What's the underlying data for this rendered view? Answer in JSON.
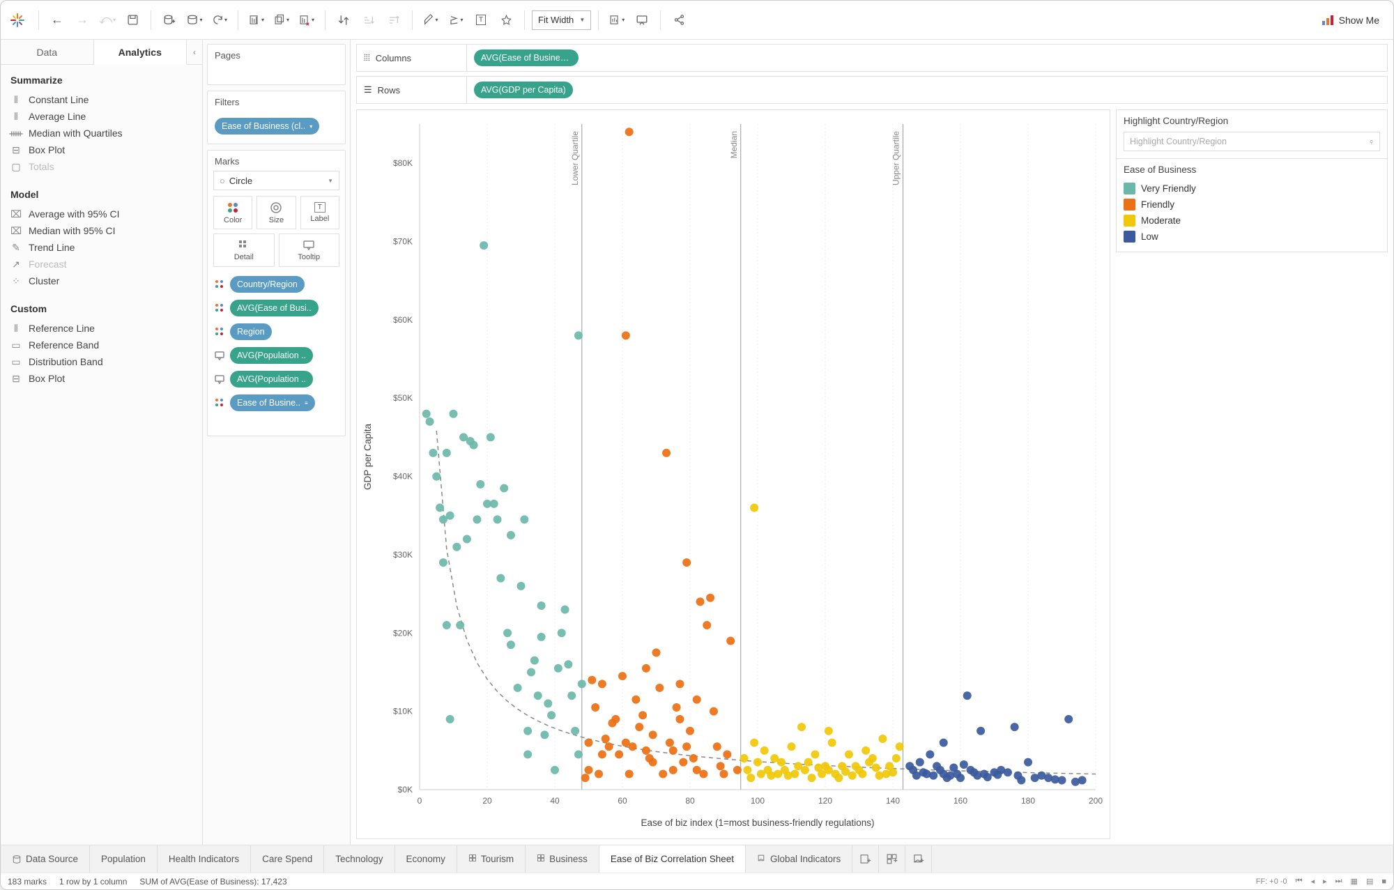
{
  "toolbar": {
    "fit_label": "Fit Width",
    "showme_label": "Show Me"
  },
  "left_tabs": {
    "data": "Data",
    "analytics": "Analytics"
  },
  "analytics": {
    "summarize": {
      "title": "Summarize",
      "items": [
        "Constant Line",
        "Average Line",
        "Median with Quartiles",
        "Box Plot",
        "Totals"
      ],
      "disabled": [
        4
      ]
    },
    "model": {
      "title": "Model",
      "items": [
        "Average with 95% CI",
        "Median with 95% CI",
        "Trend Line",
        "Forecast",
        "Cluster"
      ],
      "disabled": [
        3
      ]
    },
    "custom": {
      "title": "Custom",
      "items": [
        "Reference Line",
        "Reference Band",
        "Distribution Band",
        "Box Plot"
      ]
    }
  },
  "cards": {
    "pages": "Pages",
    "filters": "Filters",
    "filter_pill": "Ease of Business (cl..",
    "marks": "Marks",
    "mark_type": "Circle",
    "mark_cells": [
      "Color",
      "Size",
      "Label",
      "Detail",
      "Tooltip"
    ],
    "mark_pills": [
      {
        "color": "blue",
        "label": "Country/Region"
      },
      {
        "color": "teal",
        "label": "AVG(Ease of Busi.."
      },
      {
        "color": "blue",
        "label": "Region"
      },
      {
        "color": "teal",
        "label": "AVG(Population .."
      },
      {
        "color": "teal",
        "label": "AVG(Population .."
      },
      {
        "color": "blue",
        "label": "Ease of Busine.."
      }
    ]
  },
  "shelves": {
    "columns": "Columns",
    "columns_pill": "AVG(Ease of Business)",
    "rows": "Rows",
    "rows_pill": "AVG(GDP per Capita)"
  },
  "right": {
    "highlight_title": "Highlight Country/Region",
    "highlight_placeholder": "Highlight Country/Region",
    "legend_title": "Ease of Business",
    "legend": [
      {
        "label": "Very Friendly",
        "color": "#6bb7a9"
      },
      {
        "label": "Friendly",
        "color": "#ec7014"
      },
      {
        "label": "Moderate",
        "color": "#f0c808"
      },
      {
        "label": "Low",
        "color": "#3b5a9d"
      }
    ]
  },
  "sheets": {
    "data_source": "Data Source",
    "tabs": [
      "Population",
      "Health Indicators",
      "Care Spend",
      "Technology",
      "Economy",
      "Tourism",
      "Business",
      "Ease of Biz Correlation Sheet",
      "Global Indicators"
    ],
    "active": 7
  },
  "status": {
    "marks": "183 marks",
    "rows": "1 row by 1 column",
    "sum": "SUM of AVG(Ease of Business): 17,423",
    "ff": "FF: +0 -0"
  },
  "chart_data": {
    "type": "scatter",
    "title": "",
    "xlabel": "Ease of biz index (1=most business-friendly regulations)",
    "ylabel": "GDP per Capita",
    "xlim": [
      0,
      200
    ],
    "ylim": [
      0,
      85000
    ],
    "yticks": [
      0,
      10000,
      20000,
      30000,
      40000,
      50000,
      60000,
      70000,
      80000
    ],
    "yticklabels": [
      "$0K",
      "$10K",
      "$20K",
      "$30K",
      "$40K",
      "$50K",
      "$60K",
      "$70K",
      "$80K"
    ],
    "xticks": [
      0,
      20,
      40,
      60,
      80,
      100,
      120,
      140,
      160,
      180,
      200
    ],
    "refs": [
      {
        "name": "Lower Quartile",
        "x": 48
      },
      {
        "name": "Median",
        "x": 95
      },
      {
        "name": "Upper Quartile",
        "x": 143
      }
    ],
    "trend": "power-decay",
    "series": [
      {
        "name": "Very Friendly",
        "color": "#6bb7a9",
        "points": [
          [
            2,
            48000
          ],
          [
            3,
            47000
          ],
          [
            4,
            43000
          ],
          [
            5,
            40000
          ],
          [
            6,
            36000
          ],
          [
            7,
            34500
          ],
          [
            7,
            29000
          ],
          [
            8,
            43000
          ],
          [
            8,
            21000
          ],
          [
            9,
            35000
          ],
          [
            9,
            9000
          ],
          [
            10,
            48000
          ],
          [
            11,
            31000
          ],
          [
            12,
            21000
          ],
          [
            13,
            45000
          ],
          [
            14,
            32000
          ],
          [
            15,
            44500
          ],
          [
            16,
            44000
          ],
          [
            17,
            34500
          ],
          [
            18,
            39000
          ],
          [
            19,
            69500
          ],
          [
            20,
            36500
          ],
          [
            21,
            45000
          ],
          [
            22,
            36500
          ],
          [
            23,
            34500
          ],
          [
            24,
            27000
          ],
          [
            25,
            38500
          ],
          [
            26,
            20000
          ],
          [
            27,
            18500
          ],
          [
            27,
            32500
          ],
          [
            29,
            13000
          ],
          [
            30,
            26000
          ],
          [
            31,
            34500
          ],
          [
            32,
            4500
          ],
          [
            32,
            7500
          ],
          [
            33,
            15000
          ],
          [
            34,
            16500
          ],
          [
            35,
            12000
          ],
          [
            36,
            19500
          ],
          [
            36,
            23500
          ],
          [
            37,
            7000
          ],
          [
            38,
            11000
          ],
          [
            39,
            9500
          ],
          [
            40,
            2500
          ],
          [
            41,
            15500
          ],
          [
            42,
            20000
          ],
          [
            43,
            23000
          ],
          [
            44,
            16000
          ],
          [
            45,
            12000
          ],
          [
            46,
            7500
          ],
          [
            47,
            4500
          ],
          [
            47,
            58000
          ],
          [
            48,
            13500
          ]
        ]
      },
      {
        "name": "Friendly",
        "color": "#ec7014",
        "points": [
          [
            49,
            1500
          ],
          [
            50,
            6000
          ],
          [
            50,
            2500
          ],
          [
            51,
            14000
          ],
          [
            52,
            10500
          ],
          [
            53,
            2000
          ],
          [
            54,
            4500
          ],
          [
            55,
            6500
          ],
          [
            54,
            13500
          ],
          [
            56,
            5500
          ],
          [
            57,
            8500
          ],
          [
            58,
            9000
          ],
          [
            59,
            4500
          ],
          [
            60,
            14500
          ],
          [
            61,
            58000
          ],
          [
            61,
            6000
          ],
          [
            62,
            2000
          ],
          [
            62,
            84000
          ],
          [
            63,
            5500
          ],
          [
            64,
            11500
          ],
          [
            65,
            8000
          ],
          [
            66,
            9500
          ],
          [
            67,
            5000
          ],
          [
            67,
            15500
          ],
          [
            68,
            4000
          ],
          [
            69,
            3500
          ],
          [
            69,
            7000
          ],
          [
            70,
            17500
          ],
          [
            71,
            13000
          ],
          [
            72,
            2000
          ],
          [
            73,
            43000
          ],
          [
            74,
            6000
          ],
          [
            75,
            5000
          ],
          [
            75,
            2500
          ],
          [
            76,
            10500
          ],
          [
            77,
            9000
          ],
          [
            78,
            3500
          ],
          [
            79,
            29000
          ],
          [
            79,
            5500
          ],
          [
            80,
            7500
          ],
          [
            81,
            4000
          ],
          [
            82,
            2500
          ],
          [
            82,
            11500
          ],
          [
            83,
            24000
          ],
          [
            84,
            2000
          ],
          [
            85,
            21000
          ],
          [
            86,
            24500
          ],
          [
            87,
            10000
          ],
          [
            88,
            5500
          ],
          [
            89,
            3000
          ],
          [
            77,
            13500
          ],
          [
            90,
            2000
          ],
          [
            91,
            4500
          ],
          [
            92,
            19000
          ],
          [
            94,
            2500
          ]
        ]
      },
      {
        "name": "Moderate",
        "color": "#f0c808",
        "points": [
          [
            96,
            4000
          ],
          [
            97,
            2500
          ],
          [
            98,
            1500
          ],
          [
            99,
            6000
          ],
          [
            99,
            36000
          ],
          [
            100,
            3500
          ],
          [
            101,
            2000
          ],
          [
            102,
            5000
          ],
          [
            103,
            2500
          ],
          [
            104,
            1800
          ],
          [
            105,
            4000
          ],
          [
            106,
            2000
          ],
          [
            107,
            3500
          ],
          [
            108,
            2500
          ],
          [
            109,
            1800
          ],
          [
            110,
            5500
          ],
          [
            111,
            2000
          ],
          [
            112,
            3000
          ],
          [
            113,
            8000
          ],
          [
            114,
            2500
          ],
          [
            115,
            3500
          ],
          [
            116,
            1500
          ],
          [
            117,
            4500
          ],
          [
            118,
            2800
          ],
          [
            119,
            2000
          ],
          [
            120,
            3000
          ],
          [
            121,
            7500
          ],
          [
            121,
            2500
          ],
          [
            122,
            6000
          ],
          [
            123,
            2000
          ],
          [
            124,
            1500
          ],
          [
            125,
            3000
          ],
          [
            126,
            2300
          ],
          [
            127,
            4500
          ],
          [
            128,
            1800
          ],
          [
            129,
            3000
          ],
          [
            130,
            2500
          ],
          [
            131,
            2000
          ],
          [
            132,
            5000
          ],
          [
            133,
            3500
          ],
          [
            134,
            4000
          ],
          [
            135,
            2800
          ],
          [
            136,
            1800
          ],
          [
            137,
            6500
          ],
          [
            138,
            2000
          ],
          [
            139,
            3000
          ],
          [
            140,
            2200
          ],
          [
            141,
            4000
          ],
          [
            142,
            5500
          ]
        ]
      },
      {
        "name": "Low",
        "color": "#3b5a9d",
        "points": [
          [
            145,
            3000
          ],
          [
            146,
            2500
          ],
          [
            147,
            1800
          ],
          [
            148,
            3500
          ],
          [
            149,
            2200
          ],
          [
            150,
            2000
          ],
          [
            151,
            4500
          ],
          [
            152,
            1800
          ],
          [
            153,
            3000
          ],
          [
            154,
            2500
          ],
          [
            155,
            6000
          ],
          [
            155,
            2000
          ],
          [
            156,
            1500
          ],
          [
            157,
            1800
          ],
          [
            158,
            2800
          ],
          [
            159,
            2000
          ],
          [
            160,
            1500
          ],
          [
            161,
            3200
          ],
          [
            162,
            12000
          ],
          [
            163,
            2500
          ],
          [
            164,
            2200
          ],
          [
            165,
            1800
          ],
          [
            166,
            7500
          ],
          [
            167,
            2000
          ],
          [
            168,
            1600
          ],
          [
            170,
            2200
          ],
          [
            171,
            1900
          ],
          [
            172,
            2500
          ],
          [
            174,
            2200
          ],
          [
            176,
            8000
          ],
          [
            177,
            1800
          ],
          [
            178,
            1200
          ],
          [
            180,
            3500
          ],
          [
            182,
            1500
          ],
          [
            184,
            1800
          ],
          [
            186,
            1500
          ],
          [
            188,
            1300
          ],
          [
            190,
            1200
          ],
          [
            192,
            9000
          ],
          [
            194,
            1000
          ],
          [
            196,
            1200
          ]
        ]
      }
    ]
  }
}
